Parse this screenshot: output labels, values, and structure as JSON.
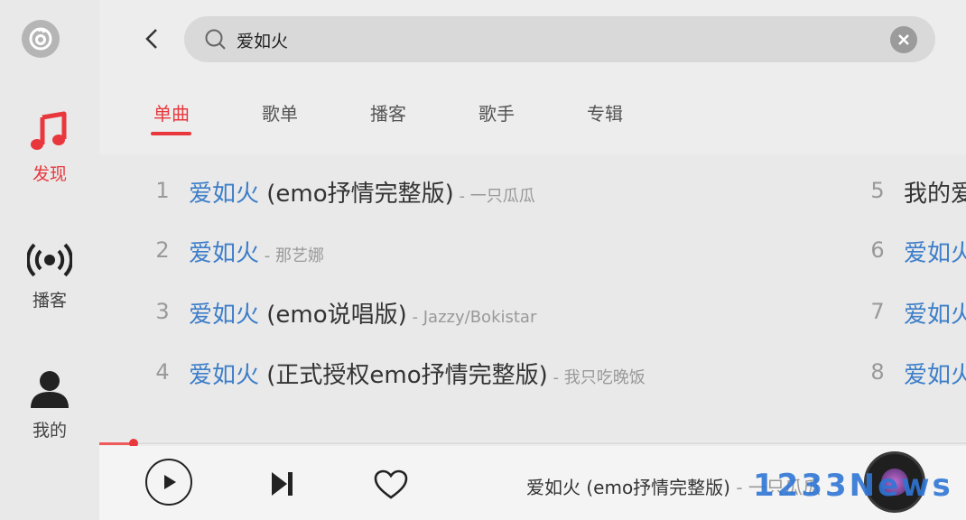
{
  "colors": {
    "accent": "#e8383d",
    "highlight": "#3d7ec9",
    "muted": "#999999"
  },
  "sidebar": {
    "logo_icon": "netease-music-logo",
    "items": [
      {
        "label": "发现",
        "icon": "music-note-icon",
        "active": true
      },
      {
        "label": "播客",
        "icon": "broadcast-icon",
        "active": false
      },
      {
        "label": "我的",
        "icon": "user-icon",
        "active": false
      }
    ]
  },
  "search": {
    "value": "爱如火",
    "back_icon": "chevron-left-icon",
    "clear_icon": "clear-icon"
  },
  "tabs": [
    {
      "label": "单曲",
      "active": true
    },
    {
      "label": "歌单",
      "active": false
    },
    {
      "label": "播客",
      "active": false
    },
    {
      "label": "歌手",
      "active": false
    },
    {
      "label": "专辑",
      "active": false
    }
  ],
  "results": [
    {
      "num": "1",
      "highlight": "爱如火",
      "rest": " (emo抒情完整版)",
      "artist": " - 一只瓜瓜"
    },
    {
      "num": "2",
      "highlight": "爱如火",
      "rest": "",
      "artist": " - 那艺娜"
    },
    {
      "num": "3",
      "highlight": "爱如火",
      "rest": " (emo说唱版)",
      "artist": " - Jazzy/Bokistar"
    },
    {
      "num": "4",
      "highlight": "爱如火",
      "rest": " (正式授权emo抒情完整版)",
      "artist": " - 我只吃晚饭"
    },
    {
      "num": "5",
      "highlight": "",
      "rest": "我的爱",
      "artist": ""
    },
    {
      "num": "6",
      "highlight": "爱如火",
      "rest": "",
      "artist": ""
    },
    {
      "num": "7",
      "highlight": "爱如火",
      "rest": "",
      "artist": ""
    },
    {
      "num": "8",
      "highlight": "爱如火",
      "rest": "",
      "artist": ""
    }
  ],
  "player": {
    "progress": 0.04,
    "title": "爱如火 (emo抒情完整版)",
    "artist": " - 一只瓜瓜",
    "play_icon": "play-icon",
    "next_icon": "skip-next-icon",
    "like_icon": "heart-icon"
  },
  "watermark": "1233News"
}
